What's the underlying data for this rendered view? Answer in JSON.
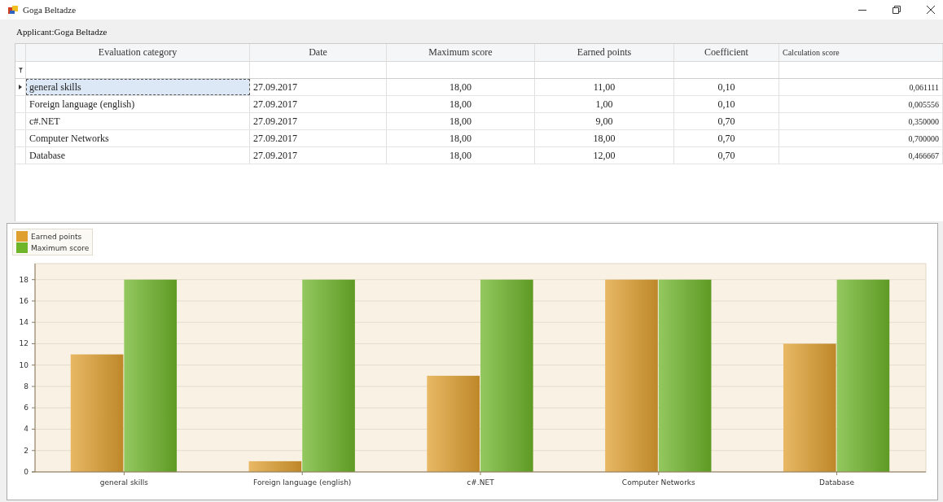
{
  "window": {
    "title": "Goga  Beltadze"
  },
  "applicant_label": "Applicant:Goga  Beltadze",
  "table": {
    "columns": [
      "Evaluation category",
      "Date",
      "Maximum score",
      "Earned points",
      "Coefficient",
      "Calculation score"
    ],
    "rows": [
      {
        "selected": true,
        "cells": [
          "general skills",
          "27.09.2017",
          "18,00",
          "11,00",
          "0,10",
          "0,061111"
        ]
      },
      {
        "selected": false,
        "cells": [
          "Foreign language (english)",
          "27.09.2017",
          "18,00",
          "1,00",
          "0,10",
          "0,005556"
        ]
      },
      {
        "selected": false,
        "cells": [
          "c#.NET",
          "27.09.2017",
          "18,00",
          "9,00",
          "0,70",
          "0,350000"
        ]
      },
      {
        "selected": false,
        "cells": [
          "Computer Networks",
          "27.09.2017",
          "18,00",
          "18,00",
          "0,70",
          "0,700000"
        ]
      },
      {
        "selected": false,
        "cells": [
          "Database",
          "27.09.2017",
          "18,00",
          "12,00",
          "0,70",
          "0,466667"
        ]
      }
    ]
  },
  "chart": {
    "chart_data": {
      "type": "bar",
      "categories": [
        "general skills",
        "Foreign language (english)",
        "c#.NET",
        "Computer Networks",
        "Database"
      ],
      "series": [
        {
          "name": "Earned points",
          "color": "#e0a030",
          "values": [
            11,
            1,
            9,
            18,
            12
          ]
        },
        {
          "name": "Maximum score",
          "color": "#6fb52a",
          "values": [
            18,
            18,
            18,
            18,
            18
          ]
        }
      ],
      "grid": true,
      "ylim": [
        0,
        19.5
      ],
      "yticks": [
        0,
        2,
        4,
        6,
        8,
        10,
        12,
        14,
        16,
        18
      ]
    }
  }
}
